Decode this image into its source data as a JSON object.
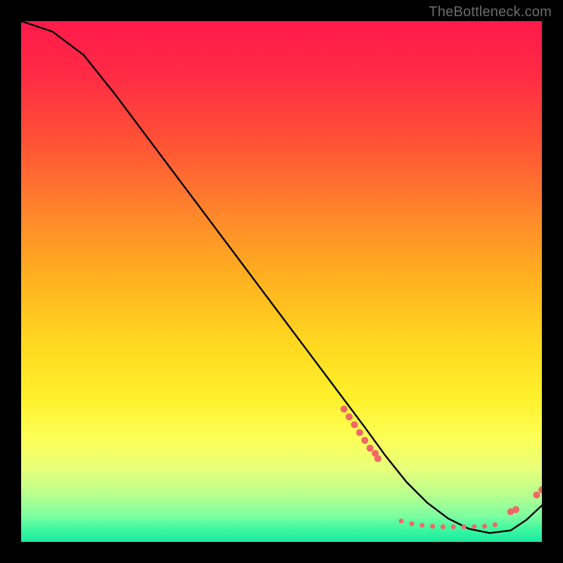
{
  "watermark": "TheBottleneck.com",
  "chart_data": {
    "type": "line",
    "title": "",
    "xlabel": "",
    "ylabel": "",
    "xlim": [
      0,
      100
    ],
    "ylim": [
      0,
      100
    ],
    "series": [
      {
        "name": "curve",
        "x": [
          0,
          6,
          12,
          18,
          24,
          30,
          36,
          42,
          48,
          54,
          60,
          66,
          70,
          74,
          78,
          82,
          86,
          90,
          94,
          97,
          100
        ],
        "y": [
          100,
          98,
          93.5,
          86,
          78,
          70,
          62,
          54,
          46,
          38,
          30,
          22,
          16.5,
          11.5,
          7.5,
          4.5,
          2.5,
          1.7,
          2.2,
          4.2,
          7
        ]
      }
    ],
    "dot_clusters": [
      {
        "xs": [
          62,
          63,
          64,
          65,
          66,
          67,
          68,
          68.5
        ],
        "ys": [
          25.5,
          24,
          22.5,
          21,
          19.5,
          18,
          17,
          16
        ],
        "r": 5,
        "color": "#f06868"
      },
      {
        "xs": [
          73,
          75,
          77,
          79,
          81,
          83,
          85,
          87,
          89,
          91
        ],
        "ys": [
          4.0,
          3.5,
          3.2,
          3.0,
          2.9,
          2.9,
          2.9,
          2.9,
          3.0,
          3.3
        ],
        "r": 3.5,
        "color": "#f06868"
      },
      {
        "xs": [
          94,
          95
        ],
        "ys": [
          5.8,
          6.2
        ],
        "r": 5,
        "color": "#f06868"
      },
      {
        "xs": [
          99,
          100
        ],
        "ys": [
          9.0,
          10.0
        ],
        "r": 5,
        "color": "#f06868"
      }
    ]
  }
}
